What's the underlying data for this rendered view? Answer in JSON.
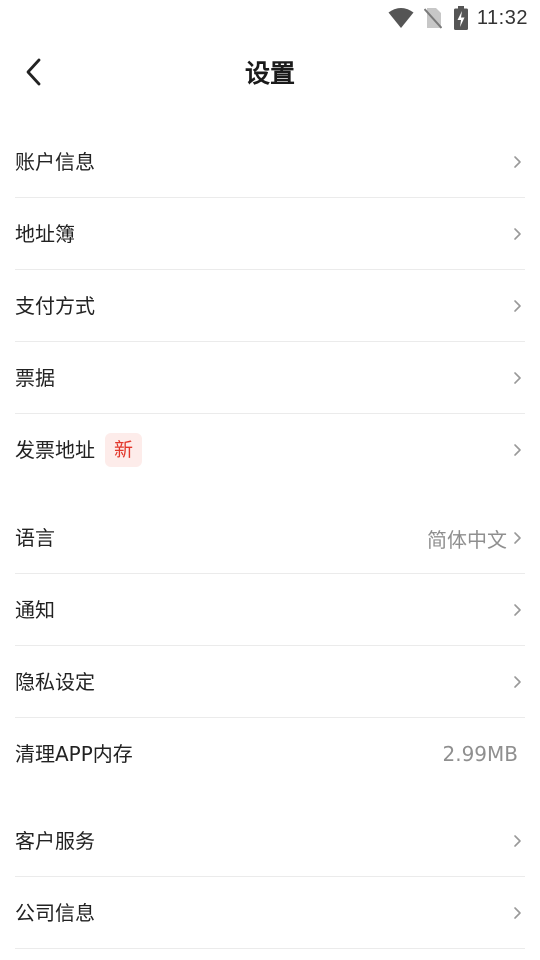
{
  "status_bar": {
    "time": "11:32",
    "icons": [
      "wifi-icon",
      "no-sim-icon",
      "battery-charging-icon"
    ]
  },
  "header": {
    "back_icon": "back-arrow-icon",
    "title": "设置"
  },
  "groups": [
    {
      "items": [
        {
          "label": "账户信息"
        },
        {
          "label": "地址簿"
        },
        {
          "label": "支付方式"
        },
        {
          "label": "票据"
        },
        {
          "label": "发票地址",
          "badge": "新"
        }
      ]
    },
    {
      "items": [
        {
          "label": "语言",
          "value": "简体中文"
        },
        {
          "label": "通知"
        },
        {
          "label": "隐私设定"
        },
        {
          "label": "清理APP内存",
          "value": "2.99MB"
        }
      ]
    },
    {
      "items": [
        {
          "label": "客户服务"
        },
        {
          "label": "公司信息"
        }
      ]
    }
  ],
  "colors": {
    "badge_text": "#e2372b",
    "badge_bg": "#fdecea",
    "divider": "#ebebeb",
    "secondary_text": "#8f8f8f"
  }
}
